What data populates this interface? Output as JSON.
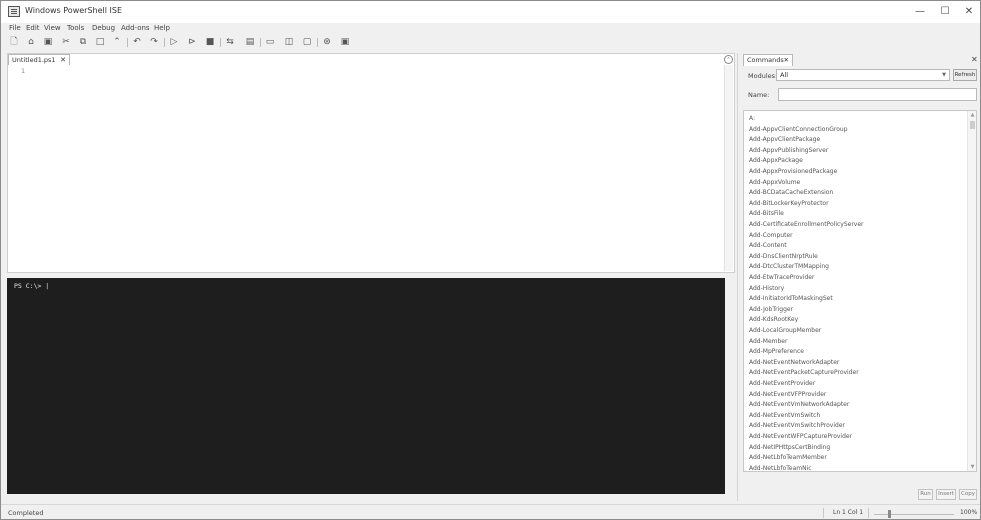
{
  "window": {
    "title": "Windows PowerShell ISE"
  },
  "menu": [
    "File",
    "Edit",
    "View",
    "Tools",
    "Debug",
    "Add-ons",
    "Help"
  ],
  "script_tab": {
    "label": "Untitled1.ps1",
    "close": "✕"
  },
  "editor": {
    "line_number": "1"
  },
  "console": {
    "prompt": "PS C:\\> |"
  },
  "commands": {
    "tab_label": "Commands",
    "modules_label": "Modules:",
    "modules_value": "All",
    "refresh_label": "Refresh",
    "name_label": "Name:",
    "items": [
      "A:",
      "Add-AppvClientConnectionGroup",
      "Add-AppvClientPackage",
      "Add-AppvPublishingServer",
      "Add-AppxPackage",
      "Add-AppxProvisionedPackage",
      "Add-AppxVolume",
      "Add-BCDataCacheExtension",
      "Add-BitLockerKeyProtector",
      "Add-BitsFile",
      "Add-CertificateEnrollmentPolicyServer",
      "Add-Computer",
      "Add-Content",
      "Add-DnsClientNrptRule",
      "Add-DtcClusterTMMapping",
      "Add-EtwTraceProvider",
      "Add-History",
      "Add-InitiatorIdToMaskingSet",
      "Add-JobTrigger",
      "Add-KdsRootKey",
      "Add-LocalGroupMember",
      "Add-Member",
      "Add-MpPreference",
      "Add-NetEventNetworkAdapter",
      "Add-NetEventPacketCaptureProvider",
      "Add-NetEventProvider",
      "Add-NetEventVFPProvider",
      "Add-NetEventVmNetworkAdapter",
      "Add-NetEventVmSwitch",
      "Add-NetEventVmSwitchProvider",
      "Add-NetEventWFPCaptureProvider",
      "Add-NetIPHttpsCertBinding",
      "Add-NetLbfoTeamMember",
      "Add-NetLbfoTeamNic"
    ],
    "buttons": [
      "Run",
      "Insert",
      "Copy"
    ]
  },
  "status": {
    "text": "Completed",
    "position": "Ln 1  Col 1",
    "zoom": "100%"
  }
}
